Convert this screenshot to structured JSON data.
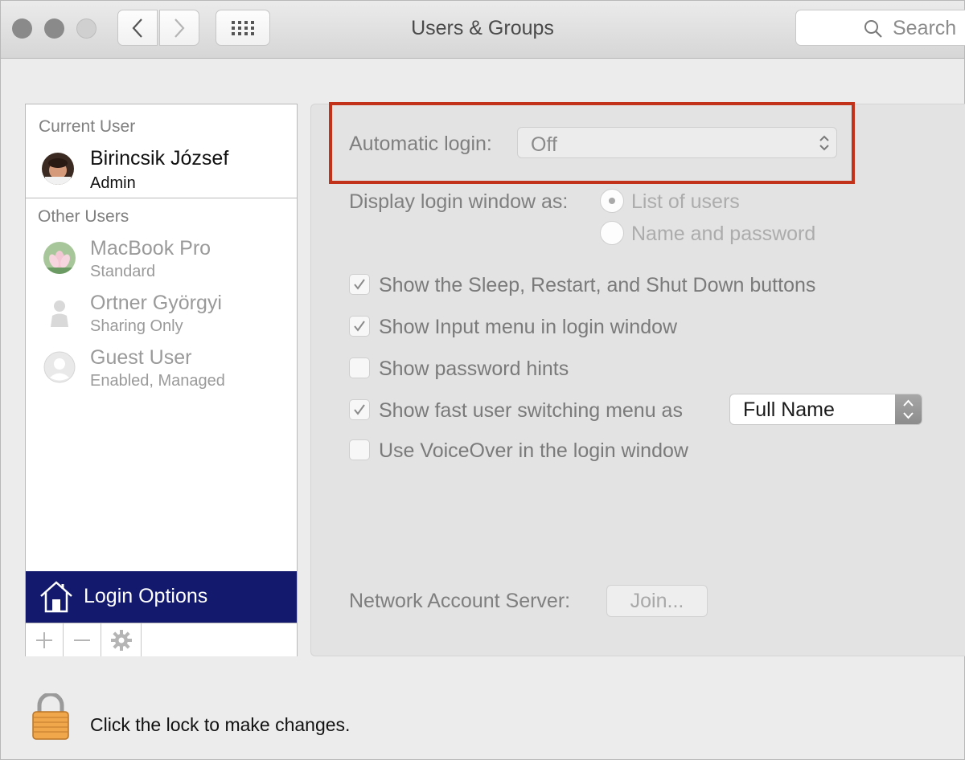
{
  "window": {
    "title": "Users & Groups",
    "search_placeholder": "Search"
  },
  "sidebar": {
    "current_user_label": "Current User",
    "current_user": {
      "name": "Birincsik József",
      "role": "Admin"
    },
    "other_users_label": "Other Users",
    "other_users": [
      {
        "name": "MacBook Pro",
        "role": "Standard"
      },
      {
        "name": "Ortner Györgyi",
        "role": "Sharing Only"
      },
      {
        "name": "Guest User",
        "role": "Enabled, Managed"
      }
    ],
    "login_options_label": "Login Options"
  },
  "main": {
    "automatic_login_label": "Automatic login:",
    "automatic_login_value": "Off",
    "display_login_label": "Display login window as:",
    "display_options": [
      "List of users",
      "Name and password"
    ],
    "display_selected": "List of users",
    "checkbox_options": [
      {
        "label": "Show the Sleep, Restart, and Shut Down buttons",
        "checked": true
      },
      {
        "label": "Show Input menu in login window",
        "checked": true
      },
      {
        "label": "Show password hints",
        "checked": false
      },
      {
        "label": "Show fast user switching menu as",
        "checked": true
      },
      {
        "label": "Use VoiceOver in the login window",
        "checked": false
      }
    ],
    "fast_user_switching_value": "Full Name",
    "network_server_label": "Network Account Server:",
    "join_button": "Join..."
  },
  "footer": {
    "lock_text": "Click the lock to make changes."
  },
  "colors": {
    "highlight": "#c2311a",
    "selected_sidebar": "#131a6e"
  }
}
